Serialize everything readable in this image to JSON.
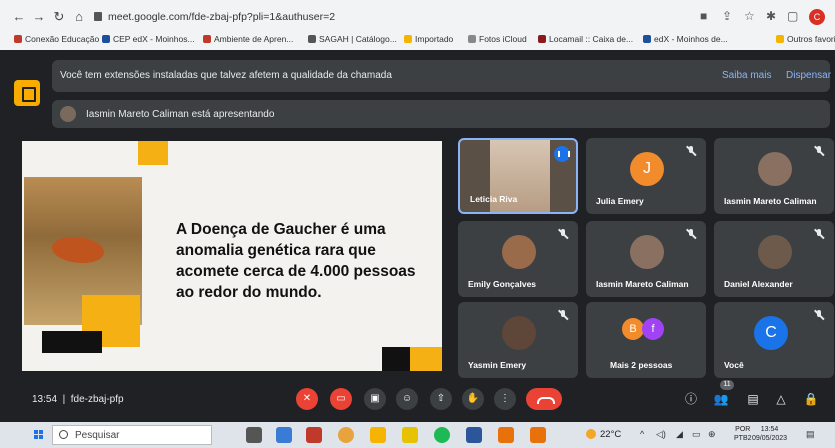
{
  "browser": {
    "url": "meet.google.com/fde-zbaj-pfp?pli=1&authuser=2",
    "profile_initial": "C",
    "bookmarks": [
      {
        "label": "Conexão Educação",
        "color": "#c0392b"
      },
      {
        "label": "CEP edX - Moinhos...",
        "color": "#1f4e9a"
      },
      {
        "label": "Ambiente de Apren...",
        "color": "#c0392b"
      },
      {
        "label": "SAGAH | Catálogo...",
        "color": "#555555"
      },
      {
        "label": "Importado",
        "color": "#f4b400"
      },
      {
        "label": "Fotos iCloud",
        "color": "#888888"
      },
      {
        "label": "Locamail :: Caixa de...",
        "color": "#8b1a1a"
      },
      {
        "label": "edX - Moinhos de...",
        "color": "#1f4e9a"
      },
      {
        "label": "Outros favoritos",
        "color": "#f4b400"
      }
    ]
  },
  "meet": {
    "banner_text": "Você tem extensões instaladas que talvez afetem a qualidade da chamada",
    "learn_more": "Saiba mais",
    "dismiss": "Dispensar",
    "presenting_text": "Iasmin Mareto Caliman está apresentando",
    "slide_text": "A Doença de Gaucher é uma anomalia genética rara que acomete cerca de 4.000 pessoas ao redor do mundo.",
    "participants": [
      {
        "name": "Leticia Riva",
        "kind": "camera"
      },
      {
        "name": "Julia Emery",
        "initial": "J",
        "color": "#f28b2c"
      },
      {
        "name": "Iasmin Mareto Caliman",
        "kind": "photo"
      },
      {
        "name": "Emily Gonçalves",
        "kind": "photo"
      },
      {
        "name": "Iasmin Mareto Caliman",
        "kind": "photo"
      },
      {
        "name": "Daniel Alexander",
        "kind": "photo"
      },
      {
        "name": "Yasmin Emery",
        "kind": "photo"
      },
      {
        "name": "Mais 2 pessoas",
        "initials": [
          "B",
          "f"
        ],
        "colors": [
          "#f28b2c",
          "#a142f4"
        ]
      },
      {
        "name": "Você",
        "initial": "C",
        "color": "#1a73e8"
      }
    ],
    "time": "13:54",
    "meeting_code": "fde-zbaj-pfp",
    "participant_count": "11"
  },
  "taskbar": {
    "search_placeholder": "Pesquisar",
    "weather": "22°C",
    "lang_1": "POR",
    "lang_2": "PTB2",
    "clock_time": "13:54",
    "clock_date": "09/05/2023"
  }
}
